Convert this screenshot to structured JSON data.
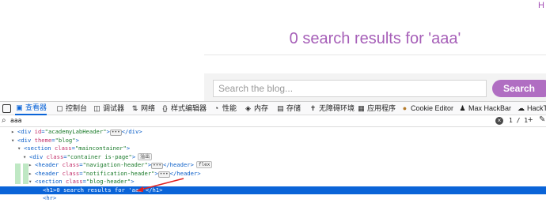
{
  "page": {
    "corner_text": "H",
    "results_heading": "0 search results for 'aaa'",
    "search": {
      "placeholder": "Search the blog...",
      "button_label": "Search"
    }
  },
  "devtools": {
    "tabs": [
      {
        "label": "查看器",
        "icon": "inspector-icon",
        "selected": true
      },
      {
        "label": "控制台",
        "icon": "console-icon"
      },
      {
        "label": "调试器",
        "icon": "debugger-icon"
      },
      {
        "label": "网络",
        "icon": "network-icon"
      },
      {
        "label": "样式编辑器",
        "icon": "style-editor-icon"
      },
      {
        "label": "性能",
        "icon": "performance-icon"
      },
      {
        "label": "内存",
        "icon": "memory-icon"
      },
      {
        "label": "存储",
        "icon": "storage-icon"
      },
      {
        "label": "无障碍环境",
        "icon": "accessibility-icon"
      },
      {
        "label": "应用程序",
        "icon": "application-icon"
      },
      {
        "label": "Cookie Editor",
        "icon": "cookie-icon"
      },
      {
        "label": "Max HackBar",
        "icon": "hackbar-icon"
      },
      {
        "label": "HackT",
        "icon": "hacktools-icon"
      }
    ],
    "search": {
      "query": "aaa",
      "count": "1 / 1"
    },
    "tree": [
      {
        "tw": "▸",
        "parts": [
          [
            "tag",
            "<div "
          ],
          [
            "attr",
            "id"
          ],
          [
            "tag",
            "="
          ],
          [
            "val",
            "\"academyLabHeader\""
          ],
          [
            "tag",
            ">"
          ]
        ],
        "tail_dots": true,
        "tail": "</div>"
      },
      {
        "tw": "▾",
        "parts": [
          [
            "tag",
            "<div "
          ],
          [
            "attr",
            "theme"
          ],
          [
            "tag",
            "="
          ],
          [
            "val",
            "\"blog\""
          ],
          [
            "tag",
            ">"
          ]
        ]
      },
      {
        "tw": "▾",
        "parts": [
          [
            "tag",
            "<section "
          ],
          [
            "attr",
            "class"
          ],
          [
            "tag",
            "="
          ],
          [
            "val",
            "\"maincontainer\""
          ],
          [
            "tag",
            ">"
          ]
        ]
      },
      {
        "tw": "▾",
        "parts": [
          [
            "tag",
            "<div "
          ],
          [
            "attr",
            "class"
          ],
          [
            "tag",
            "="
          ],
          [
            "val",
            "\"container is-page\""
          ],
          [
            "tag",
            ">"
          ]
        ],
        "pill": "溢出"
      },
      {
        "tw": "▸",
        "parts": [
          [
            "tag",
            "<header "
          ],
          [
            "attr",
            "class"
          ],
          [
            "tag",
            "="
          ],
          [
            "val",
            "\"navigation-header\""
          ],
          [
            "tag",
            ">"
          ]
        ],
        "tail_dots": true,
        "tail": "</header>",
        "pill": "flex"
      },
      {
        "tw": "▸",
        "parts": [
          [
            "tag",
            "<header "
          ],
          [
            "attr",
            "class"
          ],
          [
            "tag",
            "="
          ],
          [
            "val",
            "\"notification-header\""
          ],
          [
            "tag",
            ">"
          ]
        ],
        "tail_dots": true,
        "tail": "</header>"
      },
      {
        "tw": "▾",
        "parts": [
          [
            "tag",
            "<section "
          ],
          [
            "attr",
            "class"
          ],
          [
            "tag",
            "="
          ],
          [
            "val",
            "\"blog-header\""
          ],
          [
            "tag",
            ">"
          ]
        ]
      },
      {
        "tw": "",
        "parts": [
          [
            "tag",
            "<h1>"
          ],
          [
            "text",
            "0 search results for 'aaa'"
          ],
          [
            "tag",
            "</h1>"
          ]
        ],
        "selected": true
      },
      {
        "tw": "",
        "parts": [
          [
            "tag",
            "<hr>"
          ]
        ]
      }
    ]
  }
}
